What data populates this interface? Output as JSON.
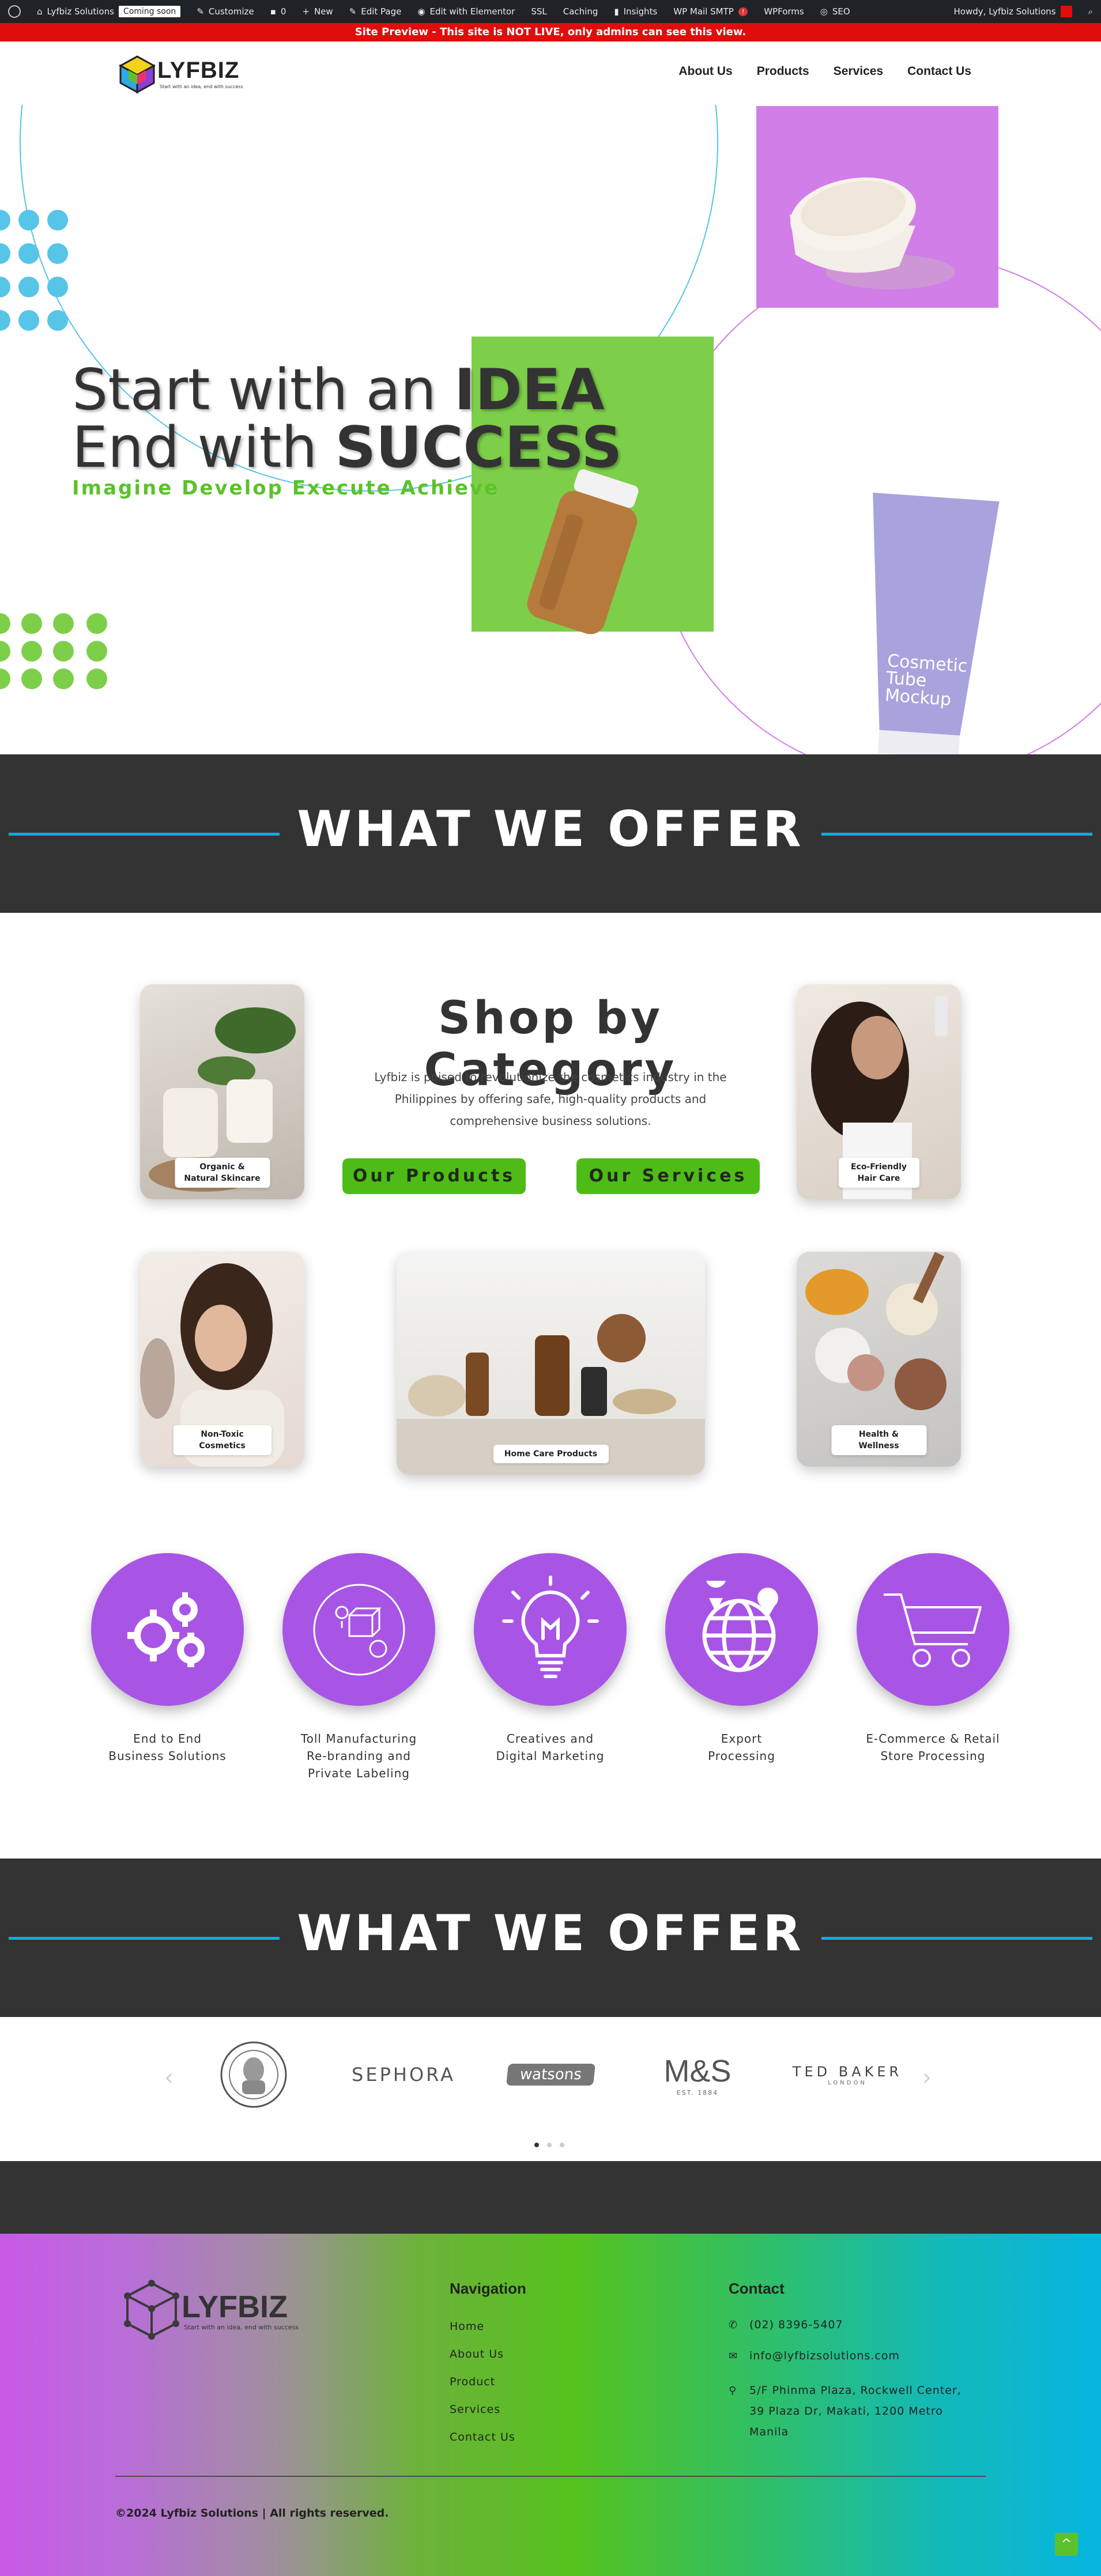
{
  "adminbar": {
    "site_name": "Lyfbiz Solutions",
    "coming_soon": "Coming soon",
    "customize": "Customize",
    "comments_count": "0",
    "new": "New",
    "edit_page": "Edit Page",
    "edit_elementor": "Edit with Elementor",
    "ssl": "SSL",
    "caching": "Caching",
    "insights": "Insights",
    "wp_mail_smtp": "WP Mail SMTP",
    "smtp_badge": "!",
    "wpforms": "WPForms",
    "seo": "SEO",
    "howdy": "Howdy, Lyfbiz Solutions"
  },
  "preview_banner": "Site Preview - This site is NOT LIVE, only admins can see this view.",
  "header": {
    "logo_text": "LYFBIZ",
    "logo_tagline": "Start with an idea, end with success",
    "nav": [
      "About Us",
      "Products",
      "Services",
      "Contact Us"
    ]
  },
  "hero": {
    "line1_normal": "Start with an ",
    "line1_bold": "IDEA",
    "line2_normal": "End with ",
    "line2_bold": "SUCCESS",
    "subtitle": "Imagine Develop Execute Achieve",
    "tube_text_1": "Cosmetic",
    "tube_text_2": "Tube",
    "tube_text_3": "Mockup",
    "colors": {
      "green": "#7dcf4a",
      "purple": "#d17ee8",
      "cyan": "#56c5e8"
    }
  },
  "offer_band_1": {
    "title": "WHAT WE OFFER"
  },
  "shop": {
    "title": "Shop by Category",
    "description": "Lyfbiz is poised to revolutionize the cosmetics industry in the Philippines by offering safe, high-quality products and comprehensive business solutions.",
    "btn_products": "Our Products",
    "btn_services": "Our Services",
    "categories": [
      "Organic & Natural Skincare",
      "Eco-Friendly Hair Care",
      "Non-Toxic Cosmetics",
      "Home Care Products",
      "Health & Wellness"
    ]
  },
  "services": [
    {
      "label": "End to End\nBusiness Solutions",
      "icon": "gears-icon"
    },
    {
      "label": "Toll Manufacturing\nRe-branding and\nPrivate Labeling",
      "icon": "manufacturing-icon"
    },
    {
      "label": "Creatives and\nDigital Marketing",
      "icon": "lightbulb-icon"
    },
    {
      "label": "Export\nProcessing",
      "icon": "globe-icon"
    },
    {
      "label": "E-Commerce & Retail\nStore Processing",
      "icon": "cart-icon"
    }
  ],
  "offer_band_2": {
    "title": "WHAT WE OFFER"
  },
  "brands": {
    "sephora": "SEPHORA",
    "watsons": "watsons",
    "ms": "M&S",
    "ms_sub": "EST. 1884",
    "tedbaker": "TED BAKER",
    "tedbaker_sub": "LONDON",
    "prev_arrow": "‹",
    "next_arrow": "›"
  },
  "footer": {
    "logo_text": "LYFBIZ",
    "logo_tagline": "Start with an idea, end with success",
    "nav_heading": "Navigation",
    "nav_links": [
      "Home",
      "About Us",
      "Product",
      "Services",
      "Contact Us"
    ],
    "contact_heading": "Contact",
    "phone": "(02) 8396-5407",
    "email": "info@lyfbizsolutions.com",
    "address_1": "5/F Phinma Plaza, Rockwell Center,",
    "address_2": "39 Plaza Dr, Makati, 1200 Metro",
    "address_3": "Manila",
    "copyright": "©2024 Lyfbiz Solutions | All rights reserved.",
    "to_top": "^"
  }
}
